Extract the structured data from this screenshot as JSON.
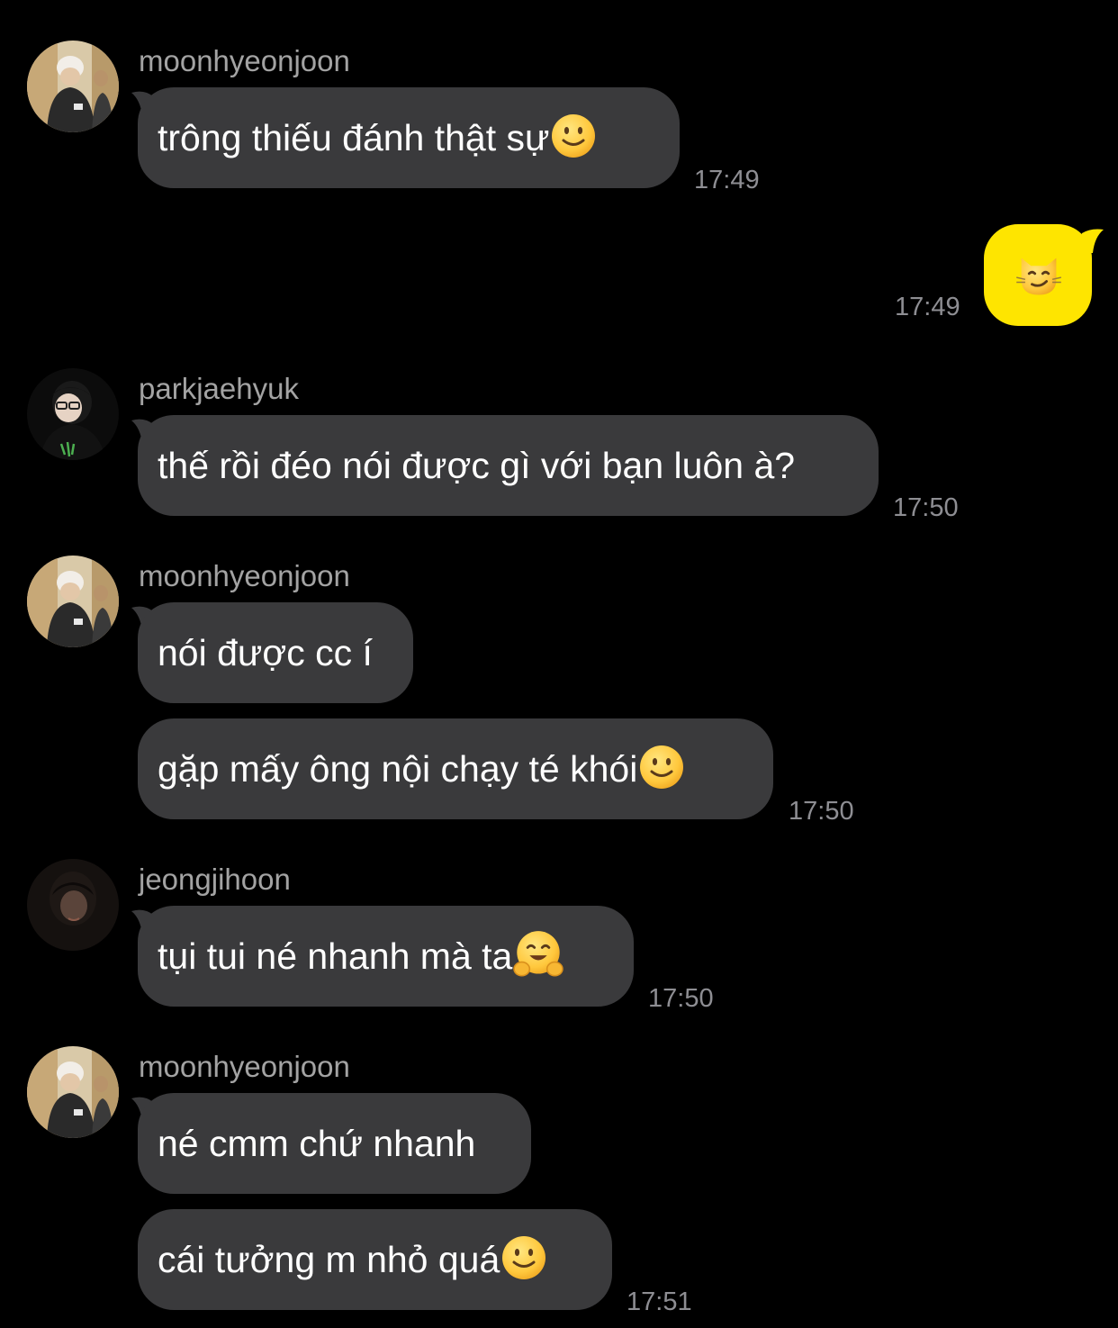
{
  "colors": {
    "background": "#000000",
    "bubble_other": "#3a3a3c",
    "bubble_me": "#fee500",
    "sender_name": "#a3a3a3",
    "timestamp": "#8e8e93"
  },
  "messages": [
    {
      "sender": "moonhyeonjoon",
      "text": "trông thiếu đánh thật sự",
      "emoji": "slightly-smiling-face-icon",
      "time": "17:49"
    },
    {
      "sender": "me",
      "text": "",
      "emoji": "smirking-cat-face-icon",
      "time": "17:49"
    },
    {
      "sender": "parkjaehyuk",
      "text": "thế rồi đéo nói được gì với bạn luôn à?",
      "time": "17:50"
    },
    {
      "sender": "moonhyeonjoon",
      "text": "nói được cc í",
      "time": ""
    },
    {
      "sender": "moonhyeonjoon",
      "text": "gặp mấy ông nội chạy té khói",
      "emoji": "slightly-smiling-face-icon",
      "time": "17:50"
    },
    {
      "sender": "jeongjihoon",
      "text": "tụi tui né nhanh mà ta",
      "emoji": "hugging-face-icon",
      "time": "17:50"
    },
    {
      "sender": "moonhyeonjoon",
      "text": "né cmm chứ nhanh",
      "time": ""
    },
    {
      "sender": "moonhyeonjoon",
      "text": "cái tưởng m nhỏ quá",
      "emoji": "slightly-smiling-face-icon",
      "time": "17:51"
    }
  ]
}
